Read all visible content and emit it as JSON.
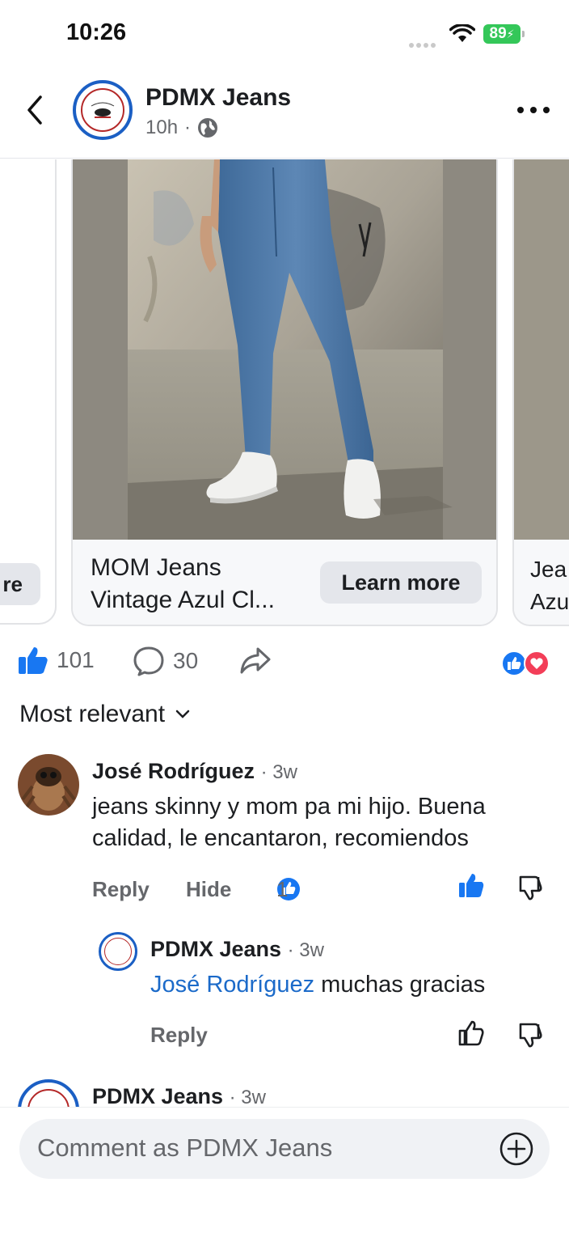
{
  "status_bar": {
    "time": "10:26",
    "battery": "89"
  },
  "header": {
    "page_name": "PDMX Jeans",
    "post_time": "10h",
    "dot": "·"
  },
  "carousel": {
    "left_card_button": "re",
    "main_card": {
      "title_line1": "MOM Jeans",
      "title_line2": "Vintage Azul Cl...",
      "button": "Learn more"
    },
    "right_card": {
      "title_line1": "Jea",
      "title_line2": "Azu"
    }
  },
  "reactions": {
    "likes": "101",
    "comments": "30"
  },
  "sort": {
    "label": "Most relevant"
  },
  "comments": [
    {
      "author": "José Rodríguez",
      "time": "· 3w",
      "text_line1": "jeans skinny y mom pa mi hijo. Buena",
      "text_line2": "calidad, le encantaron, recomiendos",
      "reply": "Reply",
      "hide": "Hide",
      "like_count": "1"
    },
    {
      "author": "PDMX Jeans",
      "time": "· 3w",
      "mention": "José Rodríguez",
      "text": " muchas gracias",
      "reply": "Reply"
    },
    {
      "author": "PDMX Jeans",
      "time": "· 3w"
    }
  ],
  "composer": {
    "placeholder": "Comment as PDMX Jeans"
  },
  "colors": {
    "brand_blue": "#1b6ac9",
    "like_blue": "#1877f2",
    "love_red": "#f33e58",
    "battery_green": "#34c759"
  }
}
